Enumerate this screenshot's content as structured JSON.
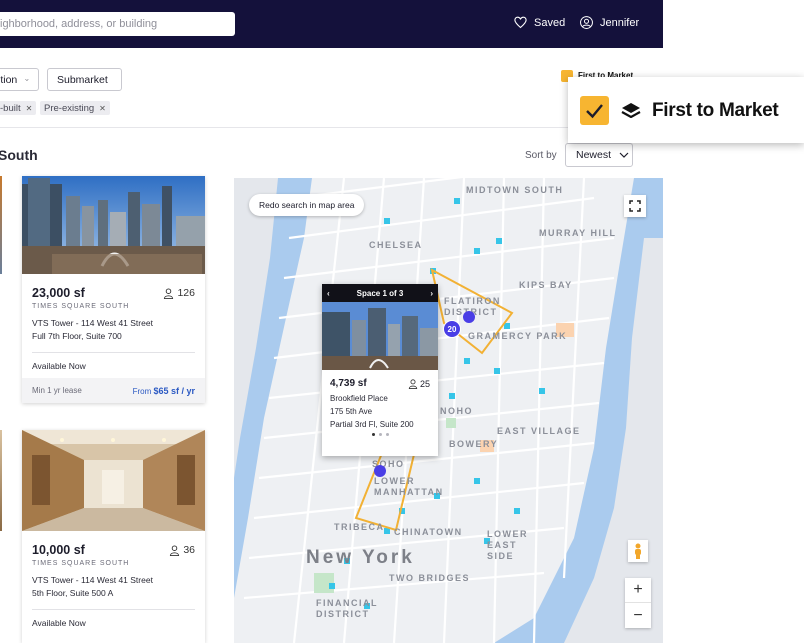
{
  "header": {
    "search_placeholder": "ighborhood, address, or building",
    "saved_label": "Saved",
    "user_label": "Jennifer"
  },
  "filters": {
    "dropdowns": [
      {
        "label": "ition"
      },
      {
        "label": "Submarket"
      }
    ],
    "chips": [
      {
        "label": "-built"
      },
      {
        "label": "Pre-existing"
      }
    ],
    "first_to_market_small": "First to Market"
  },
  "results": {
    "title": "South",
    "sort_label": "Sort by",
    "sort_value": "Newest"
  },
  "listings": [
    {
      "size": "23,000 sf",
      "capacity": "126",
      "neighborhood": "TIMES SQUARE SOUTH",
      "address": "VTS Tower - 114 West 41 Street",
      "unit": "Full 7th Floor, Suite 700",
      "availability": "Available Now",
      "lease": "Min 1 yr lease",
      "price_prefix": "From",
      "price": "$65 sf / yr"
    },
    {
      "size": "10,000 sf",
      "capacity": "36",
      "neighborhood": "TIMES SQUARE SOUTH",
      "address": "VTS Tower - 114 West 41 Street",
      "unit": "5th Floor, Suite 500 A",
      "availability": "Available Now"
    }
  ],
  "map": {
    "redo_label": "Redo search in map area",
    "cluster_count": "20",
    "city_label": "New York",
    "neighborhoods": [
      "MIDTOWN SOUTH",
      "CHELSEA",
      "MURRAY HILL",
      "KIPS BAY",
      "FLATIRON DISTRICT",
      "GRAMERCY PARK",
      "NOHO",
      "EAST VILLAGE",
      "BOWERY",
      "SOHO",
      "LOWER MANHATTAN",
      "TRIBECA",
      "CHINATOWN",
      "LOWER EAST SIDE",
      "TWO BRIDGES",
      "FINANCIAL DISTRICT"
    ],
    "zoom_in": "+",
    "zoom_out": "−",
    "popup": {
      "nav": "Space 1 of 3",
      "size": "4,739 sf",
      "capacity": "25",
      "building": "Brookfield Place",
      "street": "175 5th Ave",
      "unit": "Partial 3rd Fl, Suite 200"
    }
  },
  "callout": {
    "label": "First to Market"
  },
  "colors": {
    "nav_bg": "#14113b",
    "accent_yellow": "#f7b531",
    "pin_blue": "#4a3ee6",
    "price_blue": "#2b59c3"
  }
}
